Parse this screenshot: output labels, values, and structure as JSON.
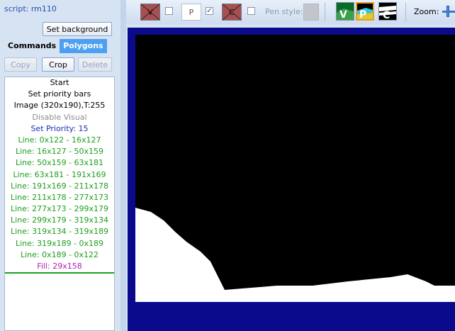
{
  "sidebar": {
    "script_label": "script: rm110",
    "set_background_label": "Set background",
    "tabs": [
      {
        "label": "Commands",
        "active": false
      },
      {
        "label": "Polygons",
        "active": true
      }
    ],
    "actions": {
      "copy_label": "Copy",
      "crop_label": "Crop",
      "delete_label": "Delete"
    },
    "commands": [
      {
        "text": "Start",
        "color": "black"
      },
      {
        "text": "Set priority bars",
        "color": "black"
      },
      {
        "text": "Image (320x190),T:255",
        "color": "black"
      },
      {
        "text": "Disable Visual",
        "color": "gray"
      },
      {
        "text": "Set Priority: 15",
        "color": "blue"
      },
      {
        "text": "Line: 0x122 - 16x127",
        "color": "green"
      },
      {
        "text": "Line: 16x127 - 50x159",
        "color": "green"
      },
      {
        "text": "Line: 50x159 - 63x181",
        "color": "green"
      },
      {
        "text": "Line: 63x181 - 191x169",
        "color": "green"
      },
      {
        "text": "Line: 191x169 - 211x178",
        "color": "green"
      },
      {
        "text": "Line: 211x178 - 277x173",
        "color": "green"
      },
      {
        "text": "Line: 277x173 - 299x179",
        "color": "green"
      },
      {
        "text": "Line: 299x179 - 319x134",
        "color": "green"
      },
      {
        "text": "Line: 319x134 - 319x189",
        "color": "green"
      },
      {
        "text": "Line: 319x189 - 0x189",
        "color": "green"
      },
      {
        "text": "Line: 0x189 - 0x122",
        "color": "green"
      },
      {
        "text": "Fill: 29x158",
        "color": "magenta",
        "selected": true
      }
    ]
  },
  "toolbar": {
    "visual_label": "V",
    "priority_label": "P",
    "control_label": "C",
    "priority_checked_mark": "✓",
    "pen_style_label": "Pen style:",
    "screen_buttons": [
      {
        "label": "V",
        "selected": false
      },
      {
        "label": "P",
        "selected": true
      },
      {
        "label": "C",
        "selected": false
      }
    ],
    "zoom_label": "Zoom:"
  },
  "colors": {
    "panel_bg": "#d6e3f3",
    "frame_blue": "#0a0a8c",
    "fill_white": "#ffffff",
    "green": "#1ea01e",
    "magenta": "#b01eb0",
    "blue": "#1a2fb0"
  }
}
